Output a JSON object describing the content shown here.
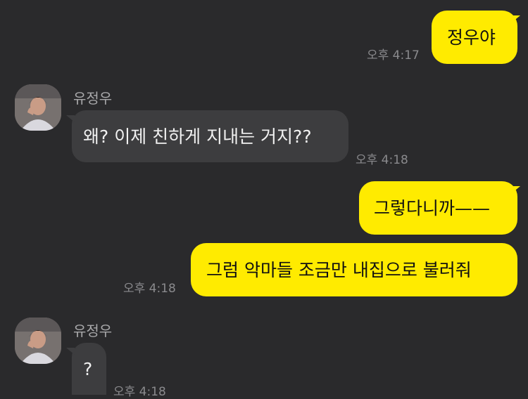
{
  "colors": {
    "background": "#2a2a2c",
    "my_bubble": "#ffeb00",
    "other_bubble": "#3d3d3f",
    "timestamp": "#8a8a8d",
    "sender_name": "#a8a8aa"
  },
  "messages": [
    {
      "from": "me",
      "text": "정우야",
      "time": "오후 4:17"
    },
    {
      "from": "other",
      "sender": "유정우",
      "avatar": "profile-photo",
      "text": "왜? 이제 친하게 지내는 거지??",
      "time": "오후 4:18"
    },
    {
      "from": "me",
      "text": "그렇다니까——"
    },
    {
      "from": "me",
      "text": "그럼 악마들 조금만 내집으로 불러줘",
      "time": "오후 4:18"
    },
    {
      "from": "other",
      "sender": "유정우",
      "avatar": "profile-photo",
      "text": "?",
      "time": "오후 4:18"
    }
  ]
}
